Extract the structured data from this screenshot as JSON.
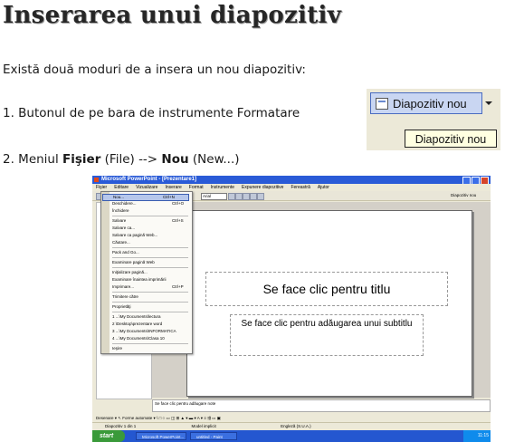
{
  "heading": "Inserarea unui diapozitiv",
  "intro": "Există două moduri de a insera un nou diapozitiv:",
  "item1": "1. Butonul de pe bara de instrumente Formatare",
  "item2": {
    "prefix": "2. Meniul ",
    "menu_file": "Fişier",
    "file_en": " (File) --> ",
    "menu_new": "Nou",
    "new_en": " (New...)"
  },
  "button_sample": {
    "label": "Diapozitiv nou",
    "tooltip": "Diapozitiv nou"
  },
  "screenshot": {
    "window_title": "Microsoft PowerPoint - [Prezentare1]",
    "menu_items": [
      "Fişier",
      "Editare",
      "Vizualizare",
      "Inserare",
      "Format",
      "Instrumente",
      "Expunere diapozitive",
      "Fereastră",
      "Ajutor"
    ],
    "font_name": "Arial",
    "new_slide_small": "Diapozitiv nou",
    "file_menu": [
      {
        "label": "Nou...",
        "shortcut": "Ctrl+N",
        "selected": true
      },
      {
        "label": "Deschidere...",
        "shortcut": "Ctrl+O"
      },
      {
        "label": "Închidere"
      },
      {
        "label": "Salvare",
        "shortcut": "Ctrl+S"
      },
      {
        "label": "Salvare ca..."
      },
      {
        "label": "Salvare ca pagină Web..."
      },
      {
        "label": "Căutare..."
      },
      {
        "label": "Pack and Go..."
      },
      {
        "label": "Examinare pagină Web"
      },
      {
        "label": "Iniţializare pagină..."
      },
      {
        "label": "Examinare înaintea imprimării"
      },
      {
        "label": "Imprimare...",
        "shortcut": "Ctrl+P"
      },
      {
        "label": "Trimitere către"
      },
      {
        "label": "Proprietăţi"
      },
      {
        "label": "1 ...\\My Documents\\lectura"
      },
      {
        "label": "2 \\Desktop\\prezentare word"
      },
      {
        "label": "3 ...\\My Documents\\INFORMATICA"
      },
      {
        "label": "4 ...\\My Documents\\Clasa 10"
      },
      {
        "label": "Ieşire"
      }
    ],
    "slide_title_placeholder": "Se face clic pentru titlu",
    "slide_subtitle_placeholder": "Se face clic pentru adăugarea unui subtitlu",
    "notes_placeholder": "Se face clic pentru adăugare note",
    "drawbar": "Desenare ▾  ↖  Forme automate ▾  \\  □  ○  ▭  ◫  ⊞  ▲ ▾  ▬ ▾  A ▾  ≡  ⇶  ▭  ▣",
    "status": [
      "Diapozitiv 1 din 1",
      "Model implicit",
      "Engleză (S.U.A.)"
    ],
    "start_label": "start",
    "taskbar_items": [
      "Microsoft PowerPoint...",
      "untitled - Paint"
    ],
    "clock": "11:15"
  }
}
